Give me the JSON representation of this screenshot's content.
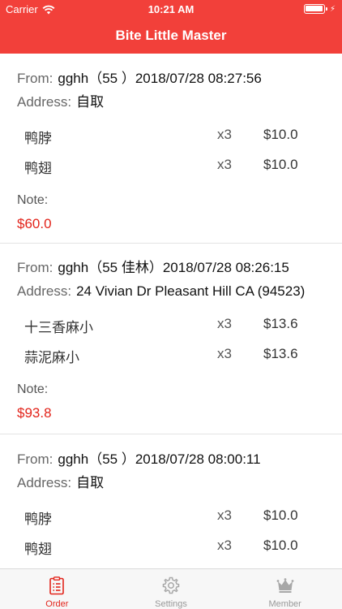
{
  "status_bar": {
    "carrier": "Carrier",
    "time": "10:21 AM",
    "battery_level": 1.0
  },
  "nav": {
    "title": "Bite Little Master"
  },
  "labels": {
    "from": "From:",
    "address": "Address:",
    "note": "Note:"
  },
  "orders": [
    {
      "from": "gghh（55  ）2018/07/28 08:27:56",
      "address": "自取",
      "items": [
        {
          "name": "鸭脖",
          "qty": "x3",
          "price": "$10.0"
        },
        {
          "name": "鸭翅",
          "qty": "x3",
          "price": "$10.0"
        }
      ],
      "note": "",
      "total": "$60.0"
    },
    {
      "from": "gghh（55  佳林）2018/07/28 08:26:15",
      "address": "24 Vivian Dr Pleasant Hill  CA  (94523)",
      "items": [
        {
          "name": "十三香麻小",
          "qty": "x3",
          "price": "$13.6"
        },
        {
          "name": "蒜泥麻小",
          "qty": "x3",
          "price": "$13.6"
        }
      ],
      "note": "",
      "total": "$93.8"
    },
    {
      "from": "gghh（55  ）2018/07/28 08:00:11",
      "address": "自取",
      "items": [
        {
          "name": "鸭脖",
          "qty": "x3",
          "price": "$10.0"
        },
        {
          "name": "鸭翅",
          "qty": "x3",
          "price": "$10.0"
        }
      ],
      "note": "",
      "total": ""
    }
  ],
  "tabs": [
    {
      "label": "Order",
      "icon": "clipboard-icon",
      "active": true
    },
    {
      "label": "Settings",
      "icon": "gear-icon",
      "active": false
    },
    {
      "label": "Member",
      "icon": "crown-icon",
      "active": false
    }
  ],
  "colors": {
    "brand": "#f2403a",
    "price_red": "#e2231a",
    "tab_inactive": "#999999"
  }
}
